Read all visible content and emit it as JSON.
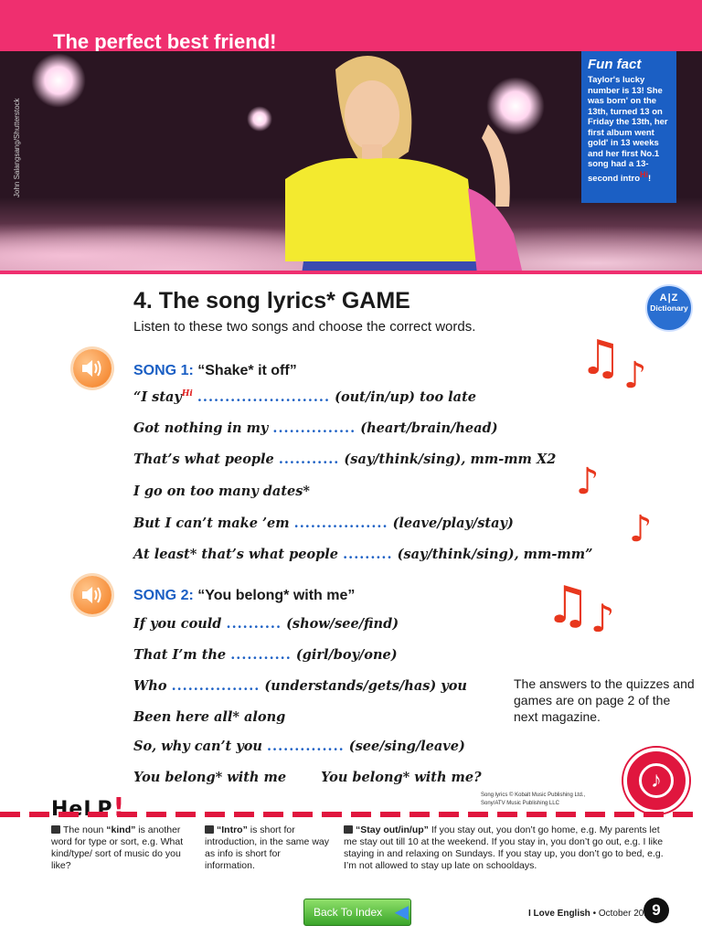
{
  "header": {
    "title": "The perfect best friend!"
  },
  "photo": {
    "credit": "John Salangsang/Shutterstock"
  },
  "funfact": {
    "title": "Fun fact",
    "text": "Taylor's lucky number is 13! She was born' on the 13th, turned 13 on Friday the 13th, her first album went gold' in 13 weeks and her first No.1 song had a 13-second intro",
    "hi": "Hi"
  },
  "section": {
    "title": "4. The song lyrics* GAME",
    "instruction": "Listen to these two songs and choose the correct words."
  },
  "dictionary": {
    "az": "A|Z",
    "label": "Dictionary"
  },
  "song1": {
    "number": "SONG 1:",
    "title": "“Shake* it off”",
    "lines": [
      {
        "pre": "“I stay",
        "hi": "Hi",
        "dots": "........................",
        "post": "(out/in/up) too late"
      },
      {
        "pre": "Got nothing in my",
        "dots": "...............",
        "post": "(heart/brain/head)"
      },
      {
        "pre": "That’s what people",
        "dots": "...........",
        "post": "(say/think/sing), mm-mm  X2"
      },
      {
        "pre": "I go on too many dates*"
      },
      {
        "pre": "But I can’t make ’em",
        "dots": ".................",
        "post": "(leave/play/stay)"
      },
      {
        "pre": "At least* that’s what people",
        "dots": ".........",
        "post": "(say/think/sing), mm-mm”"
      }
    ]
  },
  "song2": {
    "number": "SONG 2:",
    "title": "“You belong* with me”",
    "lines": [
      {
        "pre": "If you could",
        "dots": "..........",
        "post": "(show/see/find)"
      },
      {
        "pre": "That I’m the",
        "dots": "...........",
        "post": "(girl/boy/one)"
      },
      {
        "pre": "Who",
        "dots": "................",
        "post": "(understands/gets/has) you"
      },
      {
        "pre": "Been here all* along"
      },
      {
        "pre": "So, why can’t you",
        "dots": "..............",
        "post": "(see/sing/leave)"
      },
      {
        "pre": "You belong* with me",
        "post": "You belong* with me?"
      }
    ]
  },
  "answers_note": "The answers to the quizzes and games are on page 2 of the next magazine.",
  "copyright": [
    "Song lyrics © Kobalt Music Publishing Ltd.,",
    "Sony/ATV Music Publishing LLC"
  ],
  "help": {
    "label": "HeLP",
    "bang": "!",
    "kind": {
      "pre": "The noun ",
      "term": "“kind”",
      "text": " is another word for type or sort, e.g. What kind/type/ sort of music do you like?"
    },
    "intro": {
      "term": "“Intro”",
      "text": " is short for introduction, in the same way as info is short for information."
    },
    "stay": {
      "term": "“Stay out/in/up”",
      "text": " If you stay out, you don’t go home, e.g. My parents let me stay out till 10 at the weekend. If you stay in, you don’t go out, e.g. I like staying in and relaxing on Sundays. If you stay up, you don’t go to bed, e.g. I’m not allowed to stay up late on schooldays."
    }
  },
  "nav": {
    "back": "Back To Index"
  },
  "footer": {
    "brand": "I Love English",
    "date": "• October 2019",
    "page": "9"
  },
  "colors": {
    "pink": "#ef2f6f",
    "blue": "#1b5fc4",
    "red": "#e0163e",
    "orange": "#f37a1c"
  },
  "icons": [
    "speaker-icon",
    "music-note-icon",
    "book-icon",
    "arrow-left-icon"
  ]
}
